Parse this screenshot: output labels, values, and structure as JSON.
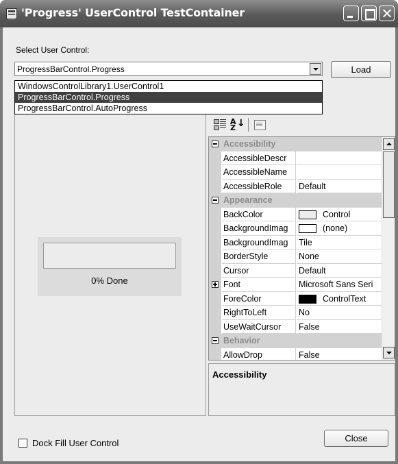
{
  "window": {
    "title": "'Progress' UserControl TestContainer"
  },
  "select": {
    "label": "Select User Control:",
    "value": "ProgressBarControl.Progress",
    "options": [
      "WindowsControlLibrary1.UserControl1",
      "ProgressBarControl.Progress",
      "ProgressBarControl.AutoProgress"
    ],
    "selected_index": 1
  },
  "buttons": {
    "load": "Load",
    "close": "Close"
  },
  "progress_control": {
    "percent": 0,
    "text": "0% Done"
  },
  "property_grid": {
    "categories": [
      {
        "title": "Accessibility",
        "expanded": true,
        "properties": [
          {
            "name": "AccessibleDescr",
            "value": ""
          },
          {
            "name": "AccessibleName",
            "value": ""
          },
          {
            "name": "AccessibleRole",
            "value": "Default"
          }
        ]
      },
      {
        "title": "Appearance",
        "expanded": true,
        "properties": [
          {
            "name": "BackColor",
            "value": "Control",
            "swatch": "#ececec"
          },
          {
            "name": "BackgroundImag",
            "value": "(none)",
            "swatch": "#ffffff"
          },
          {
            "name": "BackgroundImag",
            "value": "Tile"
          },
          {
            "name": "BorderStyle",
            "value": "None"
          },
          {
            "name": "Cursor",
            "value": "Default"
          },
          {
            "name": "Font",
            "value": "Microsoft Sans Seri",
            "expandable": true
          },
          {
            "name": "ForeColor",
            "value": "ControlText",
            "swatch": "#000000"
          },
          {
            "name": "RightToLeft",
            "value": "No"
          },
          {
            "name": "UseWaitCursor",
            "value": "False"
          }
        ]
      },
      {
        "title": "Behavior",
        "expanded": true,
        "properties": [
          {
            "name": "AllowDrop",
            "value": "False"
          }
        ]
      }
    ],
    "description_title": "Accessibility"
  },
  "dock": {
    "label": "Dock Fill User Control",
    "checked": false
  },
  "colors": {
    "selection_bg": "#404040",
    "category_text": "#8c8c8c",
    "category_bg": "#d2d2d2"
  }
}
